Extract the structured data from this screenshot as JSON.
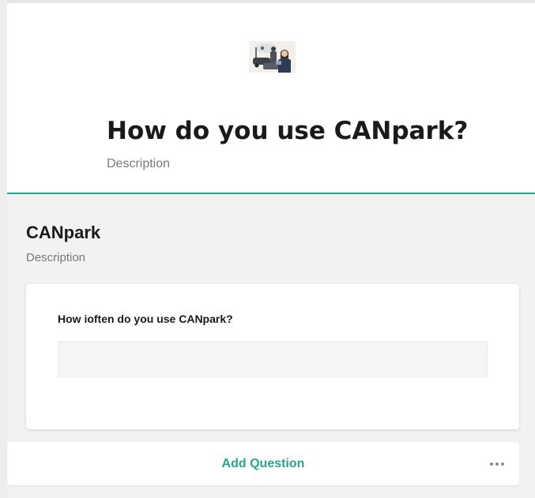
{
  "form": {
    "title": "How do you use CANpark?",
    "description": "Description"
  },
  "section": {
    "title": "CANpark",
    "description": "Description"
  },
  "question": {
    "label": "How ioften do you use CANpark?",
    "answer_value": "",
    "answer_placeholder": ""
  },
  "actions": {
    "add_question_label": "Add Question",
    "more_icon": "more-horizontal-icon"
  },
  "colors": {
    "accent": "#2aa58c",
    "page_background": "#f2f2f2",
    "card_background": "#ffffff"
  }
}
